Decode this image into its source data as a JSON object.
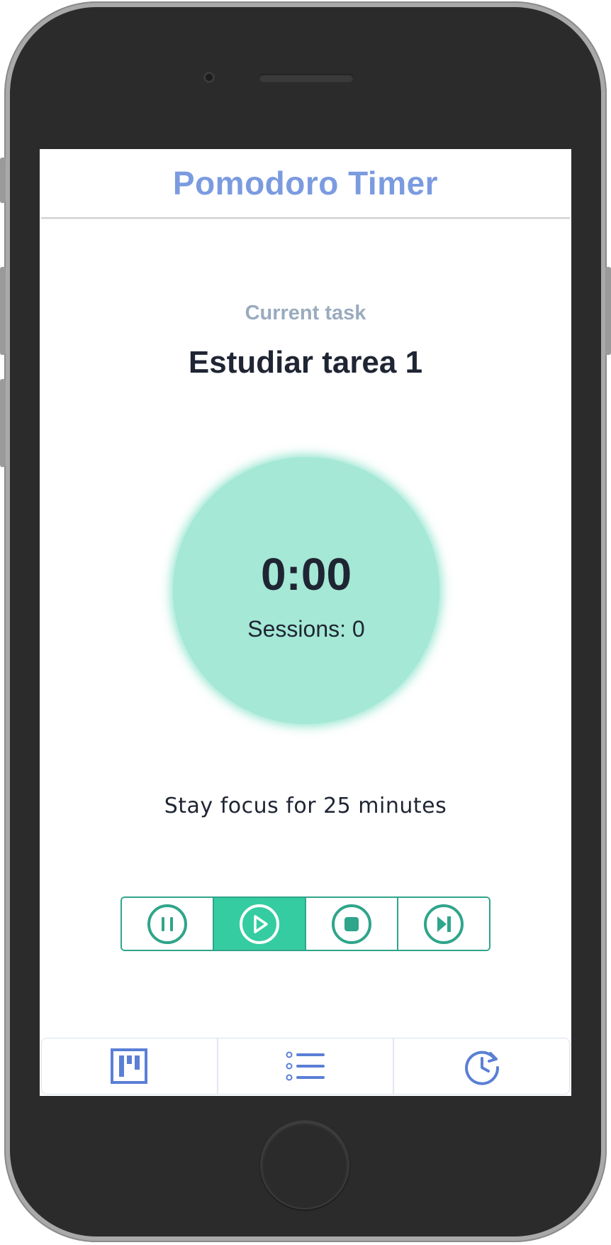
{
  "header": {
    "title": "Pomodoro Timer"
  },
  "task": {
    "label": "Current task",
    "name": "Estudiar tarea 1"
  },
  "timer": {
    "time": "0:00",
    "sessions": "Sessions: 0"
  },
  "focus_message": "Stay focus for 25 minutes",
  "controls": [
    {
      "icon": "pause-icon",
      "active": false
    },
    {
      "icon": "play-icon",
      "active": true
    },
    {
      "icon": "stop-icon",
      "active": false
    },
    {
      "icon": "skip-next-icon",
      "active": false
    }
  ],
  "tabs": [
    {
      "icon": "board-icon"
    },
    {
      "icon": "list-icon"
    },
    {
      "icon": "history-icon"
    }
  ],
  "colors": {
    "title": "#7b9be0",
    "timer_circle": "#a4e8d5",
    "accent_green": "#2fa58a",
    "active_control": "#36cca1",
    "tab_icon": "#5b7fd6"
  }
}
